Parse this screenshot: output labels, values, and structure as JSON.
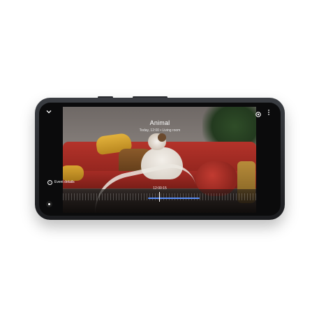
{
  "event": {
    "title": "Animal",
    "subtitle": "Today, 12:00 • Living room",
    "timestamp": "12:00:15",
    "details_label": "Event details"
  },
  "icons": {
    "back": "chevron-down-icon",
    "settings": "gear-icon",
    "more": "more-vert-icon",
    "details": "info-icon",
    "live": "live-dot-icon"
  },
  "colors": {
    "progress": "#5a8ef7",
    "screen": "#0b0b0c"
  },
  "playback": {
    "progress_fraction": 0.27
  }
}
